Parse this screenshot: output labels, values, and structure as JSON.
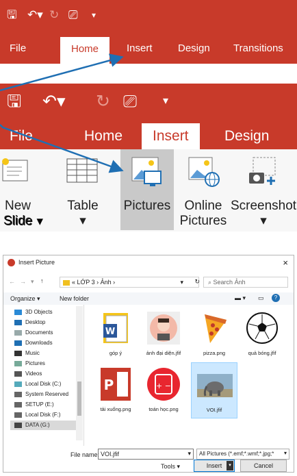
{
  "ribbon_small": {
    "tabs": [
      "File",
      "Home",
      "Insert",
      "Design",
      "Transitions"
    ]
  },
  "ribbon_large": {
    "tabs": [
      "File",
      "Home",
      "Insert",
      "Design"
    ],
    "commands": [
      {
        "label": "New Slide",
        "line2": "Slide ▾"
      },
      {
        "label": "Table",
        "line2": "▾"
      },
      {
        "label": "Pictures",
        "line2": ""
      },
      {
        "label": "Online",
        "line2": "Pictures"
      },
      {
        "label": "Screenshot",
        "line2": "▾"
      }
    ]
  },
  "dialog": {
    "title": "Insert Picture",
    "close": "×",
    "breadcrumb": "« LỚP 3 › Ảnh ›",
    "search_placeholder": "Search Ảnh",
    "organize": "Organize ▾",
    "new_folder": "New folder",
    "nav": [
      "3D Objects",
      "Desktop",
      "Documents",
      "Downloads",
      "Music",
      "Pictures",
      "Videos",
      "Local Disk (C:)",
      "System Reserved",
      "SETUP (E:)",
      "Local Disk (F:)",
      "DATA (G:)"
    ],
    "files": [
      {
        "name": "góp ý",
        "kind": "word"
      },
      {
        "name": "ảnh đại diện.jfif",
        "kind": "avatar"
      },
      {
        "name": "pizza.png",
        "kind": "pizza"
      },
      {
        "name": "quả bóng.jfif",
        "kind": "ball"
      },
      {
        "name": "tải xuống.png",
        "kind": "ppt"
      },
      {
        "name": "toán học.png",
        "kind": "math"
      },
      {
        "name": "VOI.jfif",
        "kind": "elephant"
      }
    ],
    "filename_label": "File name:",
    "filename_value": "VOI.jfif",
    "filter": "All Pictures (*.emf;*.wmf;*.jpg;*",
    "tools": "Tools",
    "insert": "Insert",
    "cancel": "Cancel"
  },
  "colors": {
    "ribbon": "#c83a2a",
    "arrow": "#1f6fb3",
    "selection": "#cce8ff"
  }
}
